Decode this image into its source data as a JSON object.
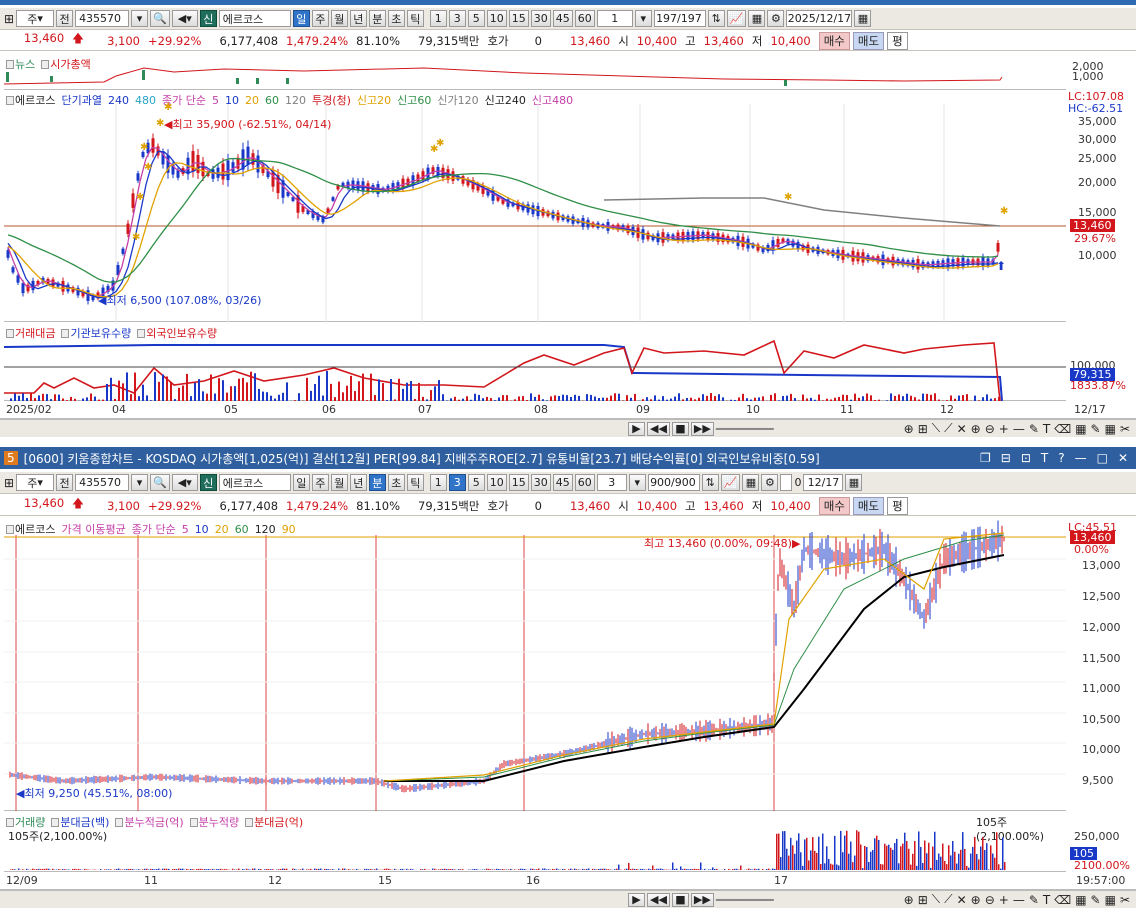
{
  "top": {
    "toolbar": {
      "type_select": "주",
      "prev": "전",
      "code": "435570",
      "badge": "신",
      "name": "에르코스",
      "periods": [
        "일",
        "주",
        "월",
        "년",
        "분",
        "초",
        "틱"
      ],
      "active_period": "일",
      "nums": [
        "1",
        "3",
        "5",
        "10",
        "15",
        "30",
        "45",
        "60"
      ],
      "unit_select": "1",
      "count": "197/197",
      "date": "2025/12/17"
    },
    "quote": {
      "price": "13,460",
      "change": "3,100",
      "change_pct": "+29.92%",
      "volume": "6,177,408",
      "vol_pct": "1,479.24%",
      "ratio": "81.10%",
      "amount": "79,315백만",
      "hoga_label": "호가",
      "hoga": "0",
      "ask": "13,460",
      "open_label": "시",
      "open": "10,400",
      "high_label": "고",
      "high": "13,460",
      "low_label": "저",
      "low": "10,400",
      "buy": "매수",
      "sell": "매도",
      "eval": "평"
    },
    "news_legend": [
      "뉴스",
      "시가총액"
    ],
    "news_axis": [
      "2,000",
      "1,000"
    ],
    "price_legend": {
      "name": "에르코스",
      "items": [
        "단기과열",
        "240",
        "480",
        "종가 단순",
        "5",
        "10",
        "20",
        "60",
        "120",
        "투경(청)",
        "신고20",
        "신고60",
        "신가120",
        "신고240",
        "신고480"
      ]
    },
    "lc": "LC:107.08",
    "hc": "HC:-62.51",
    "price_axis": [
      "35,000",
      "30,000",
      "25,000",
      "20,000",
      "15,000",
      "10,000"
    ],
    "last_tag": "13,460",
    "last_pct": "29.67%",
    "high_note": "최고 35,900 (-62.51%, 04/14)",
    "low_note": "최저 6,500 (107.08%, 03/26)",
    "vol_legend": [
      "거래대금",
      "기관보유수량",
      "외국인보유수량"
    ],
    "vol_axis": "100,000",
    "vol_tag": "79,315",
    "vol_tag2": "1833.87%",
    "x_labels": [
      "2025/02",
      "04",
      "05",
      "06",
      "07",
      "08",
      "09",
      "10",
      "11",
      "12",
      "12/17"
    ]
  },
  "bottom": {
    "title": "[0600] 키움종합차트 - KOSDAQ 시가총액[1,025(억)] 결산[12월] PER[99.84] 지배주주ROE[2.7] 유통비율[23.7] 배당수익률[0] 외국인보유비중[0.59]",
    "window_number": "5",
    "title_icons": [
      "❐",
      "⊟",
      "⊡",
      "T",
      "?",
      "—",
      "□",
      "✕"
    ],
    "toolbar": {
      "type_select": "주",
      "prev": "전",
      "code": "435570",
      "badge": "신",
      "name": "에르코스",
      "periods": [
        "일",
        "주",
        "월",
        "년",
        "분",
        "초",
        "틱"
      ],
      "active_period": "분",
      "nums": [
        "1",
        "3",
        "5",
        "10",
        "15",
        "30",
        "45",
        "60"
      ],
      "active_num": "3",
      "unit_select": "3",
      "count": "900/900",
      "zero": "0",
      "date": "12/17"
    },
    "quote": {
      "price": "13,460",
      "change": "3,100",
      "change_pct": "+29.92%",
      "volume": "6,177,408",
      "vol_pct": "1,479.24%",
      "ratio": "81.10%",
      "amount": "79,315백만",
      "hoga_label": "호가",
      "hoga": "0",
      "ask": "13,460",
      "open_label": "시",
      "open": "10,400",
      "high_label": "고",
      "high": "13,460",
      "low_label": "저",
      "low": "10,400",
      "buy": "매수",
      "sell": "매도",
      "eval": "평"
    },
    "price_legend": {
      "name": "에르코스",
      "items": [
        "가격 이동평균",
        "종가 단순",
        "5",
        "10",
        "20",
        "60",
        "120",
        "90"
      ]
    },
    "lc": "LC:45.51",
    "price_axis": [
      "13,000",
      "12,500",
      "12,000",
      "11,500",
      "11,000",
      "10,500",
      "10,000",
      "9,500"
    ],
    "last_tag": "13,460",
    "last_pct": "0.00%",
    "high_note": "최고 13,460 (0.00%, 09:48)",
    "low_note": "최저 9,250 (45.51%, 08:00)",
    "vol_legend": [
      "거래량",
      "분대금(백)",
      "분누적금(억)",
      "분누적량",
      "분대금(억)"
    ],
    "vol_note_left": "105주(2,100.00%)",
    "vol_note_right": "105주(2,100.00%)",
    "vol_axis": "250,000",
    "vol_tag": "105",
    "vol_tag2": "2100.00%",
    "x_labels": [
      "12/09",
      "11",
      "12",
      "15",
      "16",
      "17",
      "19:57:00"
    ]
  },
  "colors": {
    "up": "#d2161b",
    "down": "#1a38c8",
    "ma5": "#c43fa8",
    "ma10": "#1a38c8",
    "ma20": "#e0a200",
    "ma60": "#2f8f47",
    "ma120": "#808080"
  }
}
